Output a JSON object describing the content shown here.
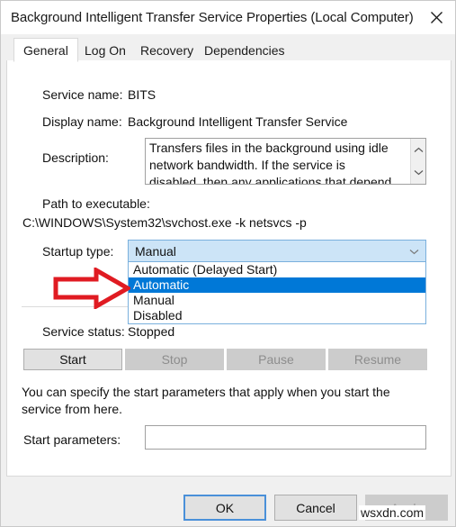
{
  "window": {
    "title": "Background Intelligent Transfer Service Properties (Local Computer)",
    "close_icon": "close-icon"
  },
  "tabs": [
    {
      "label": "General",
      "active": true
    },
    {
      "label": "Log On",
      "active": false
    },
    {
      "label": "Recovery",
      "active": false
    },
    {
      "label": "Dependencies",
      "active": false
    }
  ],
  "general": {
    "service_name_label": "Service name:",
    "service_name_value": "BITS",
    "display_name_label": "Display name:",
    "display_name_value": "Background Intelligent Transfer Service",
    "description_label": "Description:",
    "description_value": "Transfers files in the background using idle network bandwidth. If the service is disabled, then any applications that depend on BITS, such as Windows",
    "path_label": "Path to executable:",
    "path_value": "C:\\WINDOWS\\System32\\svchost.exe -k netsvcs -p",
    "startup_type_label": "Startup type:",
    "startup_type_value": "Manual",
    "startup_type_options": [
      "Automatic (Delayed Start)",
      "Automatic",
      "Manual",
      "Disabled"
    ],
    "startup_type_selected": "Automatic",
    "service_status_label": "Service status:",
    "service_status_value": "Stopped",
    "buttons": {
      "start": "Start",
      "stop": "Stop",
      "pause": "Pause",
      "resume": "Resume"
    },
    "hint_text": "You can specify the start parameters that apply when you start the service from here.",
    "start_params_label": "Start parameters:",
    "start_params_value": ""
  },
  "footer": {
    "ok": "OK",
    "cancel": "Cancel",
    "apply": "Apply"
  },
  "annotation": {
    "arrow_color": "#e01b22",
    "arrow_name": "red-pointer-arrow"
  },
  "watermark": "wsxdn.com",
  "colors": {
    "selection_blue": "#0078d7",
    "combo_focus_fill": "#cce4f7",
    "panel_bg": "#ffffff",
    "window_bg": "#f0f0f0"
  }
}
